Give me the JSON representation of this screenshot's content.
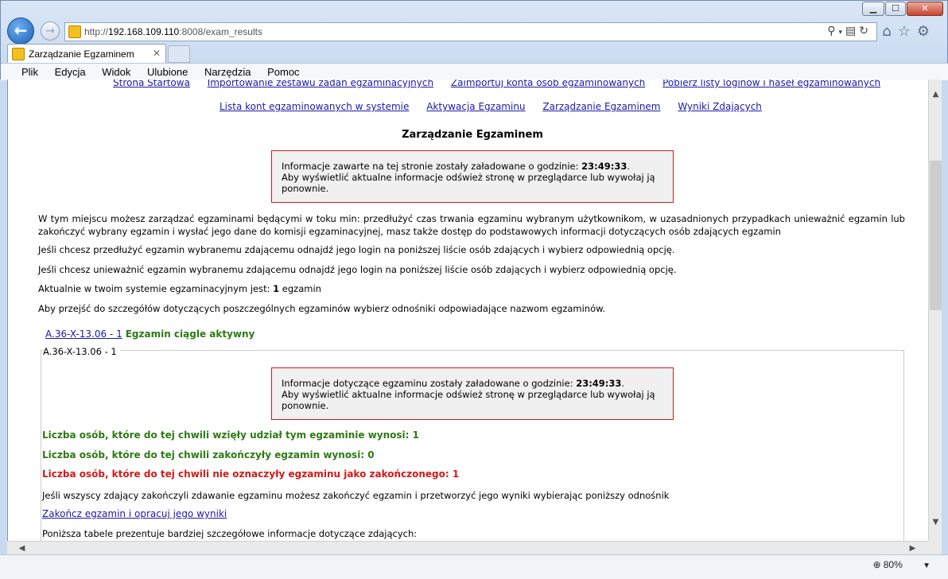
{
  "window": {
    "minimize": "▁",
    "maximize": "☐",
    "close": "✕"
  },
  "browser": {
    "url_prefix": "http://",
    "url_host": "192.168.109.110",
    "url_rest": ":8008/exam_results",
    "tab_title": "Zarządzanie Egzaminem",
    "menu": [
      "Plik",
      "Edycja",
      "Widok",
      "Ulubione",
      "Narzędzia",
      "Pomoc"
    ],
    "zoom": "80%"
  },
  "nav": {
    "row1": [
      "Strona Startowa",
      "Importowanie zestawu zadań egzaminacyjnych",
      "Zaimportuj konta osób egzaminowanych",
      "Pobierz listy loginów i haseł egzaminowanych"
    ],
    "row2": [
      "Lista kont egzaminowanych w systemie",
      "Aktywacja Egzaminu",
      "Zarządzanie Egzaminem",
      "Wyniki Zdających"
    ]
  },
  "page": {
    "title": "Zarządzanie Egzaminem",
    "info1_text": "Informacje zawarte na tej stronie zostały załadowane o godzinie: ",
    "info1_time": "23:49:33",
    "info1_refresh": "Aby wyświetlić aktualne informacje odśwież stronę w przeglądarce lub wywołaj ją ponownie.",
    "intro": "W tym miejscu możesz zarządzać egzaminami będącymi w toku min: przedłużyć czas trwania egzaminu wybranym użytkownikom, w uzasadnionych przypadkach unieważnić egzamin lub zakończyć wybrany egzamin i wysłać jego dane do komisji egzaminacyjnej, masz także dostęp do podstawowych informacji dotyczących osób zdających egzamin",
    "extend": "Jeśli chcesz przedłużyć egzamin wybranemu zdającemu odnajdź jego login na poniższej liście osób zdających i wybierz odpowiednią opcję.",
    "invalidate": "Jeśli chcesz unieważnić egzamin wybranemu zdającemu odnajdź jego login na poniższej liście osób zdających i wybierz odpowiednią opcję.",
    "count_prefix": "Aktualnie w twoim systemie egzaminacyjnym jest: ",
    "count_value": "1",
    "count_suffix": " egzamin",
    "details_hint": "Aby przejść do szczegółów dotyczących poszczególnych egzaminów wybierz odnośniki odpowiadające nazwom egzaminów.",
    "exam_link": "A.36-X-13.06 - 1",
    "exam_status": "Egzamin ciągle aktywny",
    "legend": "A.36-X-13.06 - 1",
    "info2_text": "Informacje dotyczące egzaminu zostały załadowane o godzinie: ",
    "info2_time": "23:49:33",
    "info2_refresh": "Aby wyświetlić aktualne informacje odśwież stronę w przeglądarce lub wywołaj ją ponownie.",
    "stat_started": "Liczba osób, które do tej chwili wzięły udział tym egzaminie wynosi: 1",
    "stat_finished": "Liczba osób, które do tej chwili zakończyły egzamin wynosi: 0",
    "stat_unfinished": "Liczba osób, które do tej chwili nie oznaczyły egzaminu jako zakończonego: 1",
    "finish_hint": "Jeśli wszyscy zdający zakończyli zdawanie egzaminu możesz zakończyć egzamin i przetworzyć jego wyniki wybierając poniższy odnośnik",
    "finish_link": "Zakończ egzamin i opracuj jego wyniki",
    "table_hint": "Poniższa tabele prezentuje bardziej szczegółowe informacje dotyczące zdających:"
  },
  "colors": {
    "link": "#1a1aa6",
    "ok_green": "#2d7a14",
    "alert_red": "#d21a1a",
    "infobox_border": "#c32020"
  }
}
